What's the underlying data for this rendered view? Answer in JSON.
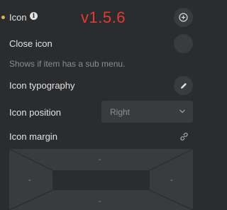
{
  "version_badge": "v1.5.6",
  "icon_row": {
    "label": "Icon",
    "info_glyph": "i",
    "button_icon": "plus-circle-icon"
  },
  "close_icon_row": {
    "label": "Close icon"
  },
  "help_text": "Shows if item has a sub menu.",
  "typography_row": {
    "label": "Icon typography",
    "button_icon": "pencil-icon"
  },
  "position_row": {
    "label": "Icon position",
    "value": "Right"
  },
  "margin_row": {
    "label": "Icon margin",
    "link_icon": "link-icon",
    "top": "-",
    "right": "-",
    "bottom": "-",
    "left": "-"
  },
  "colors": {
    "background": "#2b2c2e",
    "control": "#3a3b3e",
    "accent_dot": "#d8b84a",
    "version": "#e23b36"
  }
}
